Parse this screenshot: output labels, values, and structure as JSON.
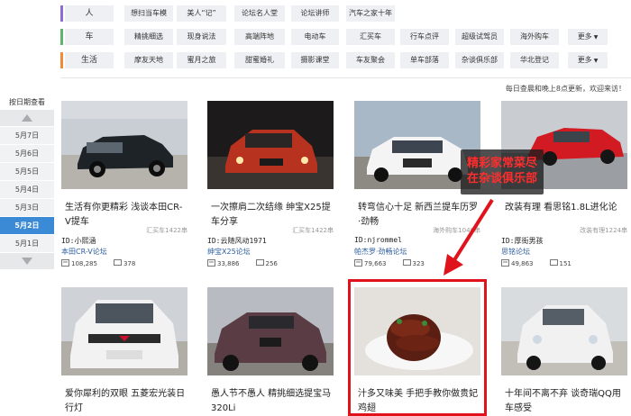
{
  "nav": {
    "rows": [
      {
        "category": "人",
        "color": "#8e6fd0",
        "tags": [
          "想扫当车模",
          "美人“记”",
          "论坛名人堂",
          "论坛讲师",
          "汽车之家十年"
        ]
      },
      {
        "category": "车",
        "color": "#5fb66b",
        "tags": [
          "精挑细选",
          "现身说法",
          "高端阵地",
          "电动车",
          "汇买车",
          "行车点评",
          "超级试驾员",
          "海外购车",
          "更多"
        ]
      },
      {
        "category": "生活",
        "color": "#f08b3a",
        "tags": [
          "摩友天地",
          "蜜月之旅",
          "甜蜜婚礼",
          "摄影课堂",
          "车友聚会",
          "单车部落",
          "杂谈俱乐部",
          "华北登记",
          "更多"
        ]
      }
    ],
    "more_caret": "▼"
  },
  "notice": "每日查晨和晚上8点更新，欢迎来访！",
  "sidebar": {
    "title": "按日期查看",
    "dates": [
      "5月7日",
      "5月6日",
      "5月5日",
      "5月4日",
      "5月3日",
      "5月2日",
      "5月1日"
    ],
    "active": "5月2日"
  },
  "cards": [
    {
      "title": "生活有你更精彩 浅谈本田CR-V提车",
      "sub": "汇买车1422串",
      "author": "ID:小熙涵",
      "forum": "本田CR-V论坛",
      "views": "108,285",
      "replies": "378"
    },
    {
      "title": "一次擦肩二次结缘 绅宝X25提车分享",
      "sub": "汇买车1422串",
      "author": "ID:云随风动1971",
      "forum": "绅宝X25论坛",
      "views": "33,886",
      "replies": "256"
    },
    {
      "title": "转弯信心十足 新西兰提车历罗·劲畅",
      "sub": "海外购车1040串",
      "author": "ID:njrommel",
      "forum": "帕杰罗·劲畅论坛",
      "views": "79,663",
      "replies": "323"
    },
    {
      "title": "改装有理 看思铭1.8L进化论",
      "sub": "改装有理1224串",
      "author": "ID:厚街男孩",
      "forum": "思铭论坛",
      "views": "49,863",
      "replies": "151"
    },
    {
      "title": "爱你犀利的双眼 五菱宏光装日行灯",
      "sub": "",
      "author": "",
      "forum": "",
      "views": "",
      "replies": ""
    },
    {
      "title": "愚人节不愚人 精挑细选提宝马320Li",
      "sub": "",
      "author": "",
      "forum": "",
      "views": "",
      "replies": ""
    },
    {
      "title": "汁多又味美 手把手教你做贵妃鸡翅",
      "sub": "",
      "author": "",
      "forum": "",
      "views": "",
      "replies": ""
    },
    {
      "title": "十年间不离不弃 谈奇瑞QQ用车感受",
      "sub": "",
      "author": "",
      "forum": "",
      "views": "",
      "replies": ""
    }
  ],
  "overlay": {
    "ad_text": "精彩家常菜尽在杂谈俱乐部"
  },
  "colors": {
    "active_date": "#3a8ad6",
    "highlight": "#e0131c",
    "arrow": "#e0131c",
    "forum_link": "#2b5d9e"
  }
}
